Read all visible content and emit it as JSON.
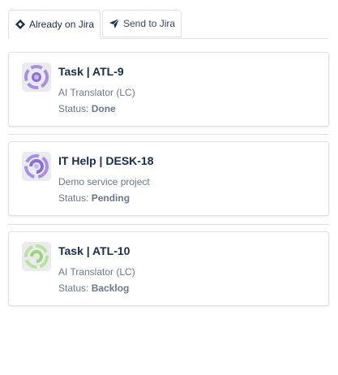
{
  "tabs": [
    {
      "label": "Already on Jira",
      "icon": "jira-diamond-icon",
      "active": true
    },
    {
      "label": "Send to Jira",
      "icon": "send-icon",
      "active": false
    }
  ],
  "issues": [
    {
      "title": "Task | ATL-9",
      "project": "AI Translator (LC)",
      "status_label": "Status:",
      "status": "Done",
      "avatar_color": "#8b6fd6",
      "icon": "project-avatar-icon"
    },
    {
      "title": "IT Help | DESK-18",
      "project": "Demo service project",
      "status_label": "Status:",
      "status": "Pending",
      "avatar_color": "#8b6fd6",
      "icon": "project-avatar-icon"
    },
    {
      "title": "Task | ATL-10",
      "project": "AI Translator (LC)",
      "status_label": "Status:",
      "status": "Backlog",
      "avatar_color": "#9fd37a",
      "icon": "project-avatar-icon"
    }
  ]
}
